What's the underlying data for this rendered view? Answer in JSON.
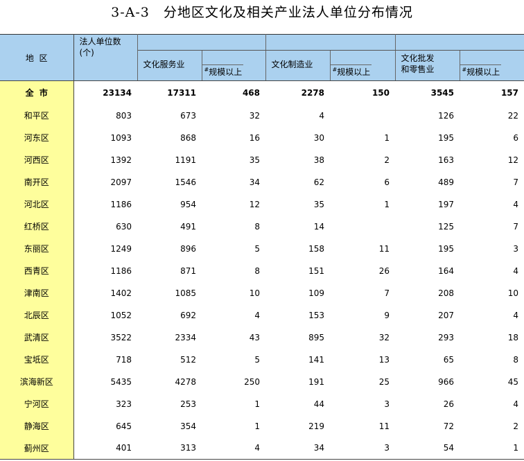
{
  "title": "3-A-3　分地区文化及相关产业法人单位分布情况",
  "headers": {
    "region": "地  区",
    "total_line1": "法人单位数",
    "total_line2": "(个)",
    "service": "文化服务业",
    "manufacturing": "文化制造业",
    "wholesale_line1": "文化批发",
    "wholesale_line2": "和零售业",
    "above_scale_mark": "#",
    "above_scale": "规模以上"
  },
  "total_row": {
    "region": "全  市",
    "values": [
      "23134",
      "17311",
      "468",
      "2278",
      "150",
      "3545",
      "157"
    ]
  },
  "rows": [
    {
      "region": "和平区",
      "values": [
        "803",
        "673",
        "32",
        "4",
        "",
        "126",
        "22"
      ]
    },
    {
      "region": "河东区",
      "values": [
        "1093",
        "868",
        "16",
        "30",
        "1",
        "195",
        "6"
      ]
    },
    {
      "region": "河西区",
      "values": [
        "1392",
        "1191",
        "35",
        "38",
        "2",
        "163",
        "12"
      ]
    },
    {
      "region": "南开区",
      "values": [
        "2097",
        "1546",
        "34",
        "62",
        "6",
        "489",
        "7"
      ]
    },
    {
      "region": "河北区",
      "values": [
        "1186",
        "954",
        "12",
        "35",
        "1",
        "197",
        "4"
      ]
    },
    {
      "region": "红桥区",
      "values": [
        "630",
        "491",
        "8",
        "14",
        "",
        "125",
        "7"
      ]
    },
    {
      "region": "东丽区",
      "values": [
        "1249",
        "896",
        "5",
        "158",
        "11",
        "195",
        "3"
      ]
    },
    {
      "region": "西青区",
      "values": [
        "1186",
        "871",
        "8",
        "151",
        "26",
        "164",
        "4"
      ]
    },
    {
      "region": "津南区",
      "values": [
        "1402",
        "1085",
        "10",
        "109",
        "7",
        "208",
        "10"
      ]
    },
    {
      "region": "北辰区",
      "values": [
        "1052",
        "692",
        "4",
        "153",
        "9",
        "207",
        "4"
      ]
    },
    {
      "region": "武清区",
      "values": [
        "3522",
        "2334",
        "43",
        "895",
        "32",
        "293",
        "18"
      ]
    },
    {
      "region": "宝坻区",
      "values": [
        "718",
        "512",
        "5",
        "141",
        "13",
        "65",
        "8"
      ]
    },
    {
      "region": "滨海新区",
      "values": [
        "5435",
        "4278",
        "250",
        "191",
        "25",
        "966",
        "45"
      ]
    },
    {
      "region": "宁河区",
      "values": [
        "323",
        "253",
        "1",
        "44",
        "3",
        "26",
        "4"
      ]
    },
    {
      "region": "静海区",
      "values": [
        "645",
        "354",
        "1",
        "219",
        "11",
        "72",
        "2"
      ]
    },
    {
      "region": "蓟州区",
      "values": [
        "401",
        "313",
        "4",
        "34",
        "3",
        "54",
        "1"
      ]
    }
  ],
  "colors": {
    "header_bg": "#abd1ef",
    "region_bg": "#fefe9c"
  }
}
